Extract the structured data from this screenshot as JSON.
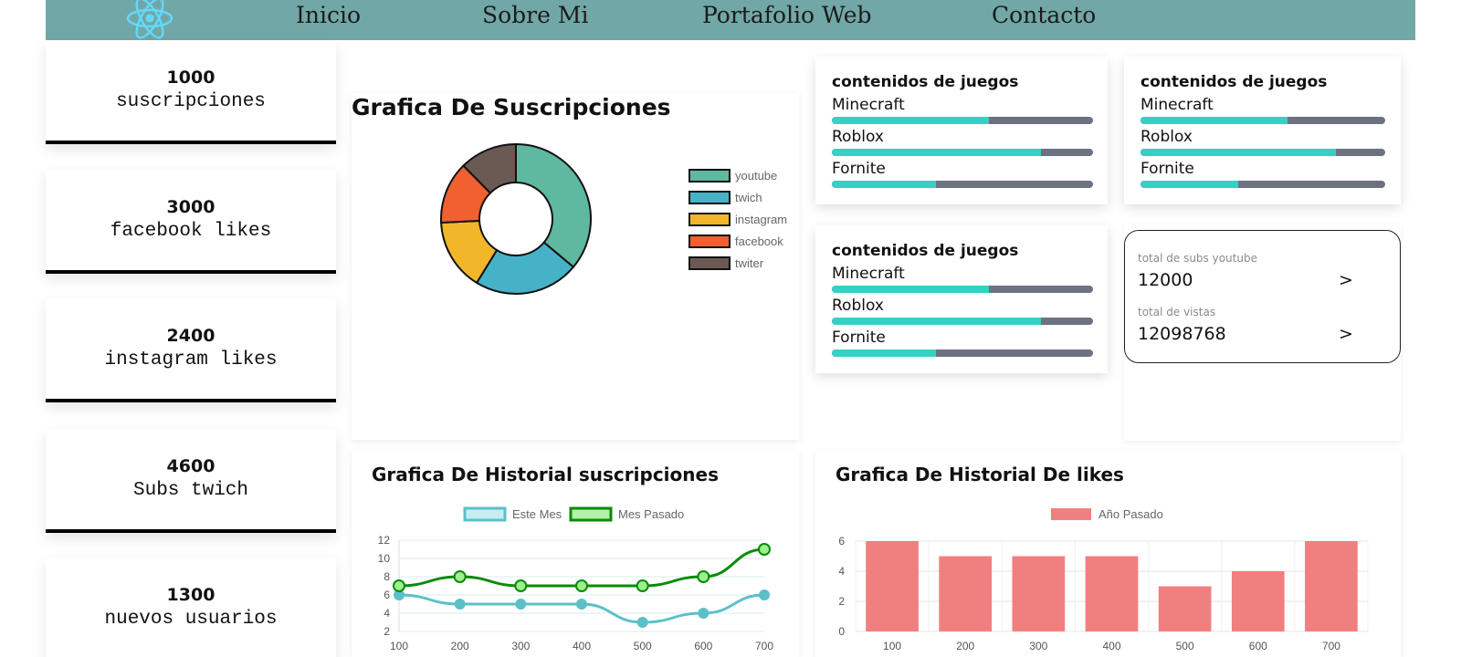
{
  "nav": {
    "links": [
      "Inicio",
      "Sobre Mi",
      "Portafolio Web",
      "Contacto"
    ],
    "logo_icon": "react-atom-icon",
    "logo_color": "#61dafb",
    "bg_color": "#72a7a7"
  },
  "stats": [
    {
      "value": "1000",
      "label": "suscripciones"
    },
    {
      "value": "3000",
      "label": "facebook likes"
    },
    {
      "value": "2400",
      "label": "instagram likes"
    },
    {
      "value": "4600",
      "label": "Subs twich"
    },
    {
      "value": "1300",
      "label": "nuevos usuarios"
    }
  ],
  "game_cards": [
    {
      "title": "contenidos de juegos",
      "items": [
        {
          "name": "Minecraft",
          "progress": 0.6
        },
        {
          "name": "Roblox",
          "progress": 0.8
        },
        {
          "name": "Fornite",
          "progress": 0.4
        }
      ]
    },
    {
      "title": "contenidos de juegos",
      "items": [
        {
          "name": "Minecraft",
          "progress": 0.6
        },
        {
          "name": "Roblox",
          "progress": 0.8
        },
        {
          "name": "Fornite",
          "progress": 0.4
        }
      ]
    },
    {
      "title": "contenidos de juegos",
      "items": [
        {
          "name": "Minecraft",
          "progress": 0.6
        },
        {
          "name": "Roblox",
          "progress": 0.8
        },
        {
          "name": "Fornite",
          "progress": 0.4
        }
      ]
    }
  ],
  "totals": {
    "subs_label": "total de subs youtube",
    "subs_value": "12000",
    "views_label": "total de vistas",
    "views_value": "12098768",
    "arrow": ">"
  },
  "colors": {
    "bar_fill": "#33d2c4",
    "bar_track": "#6d7280"
  },
  "chart_data": [
    {
      "type": "pie",
      "variant": "doughnut",
      "title": "Grafica De Suscripciones",
      "labels": [
        "youtube",
        "twich",
        "instagram",
        "facebook",
        "twiter"
      ],
      "values": [
        35,
        22,
        15,
        13,
        12
      ],
      "colors": [
        "#5fb8a0",
        "#45b2c7",
        "#f1b62a",
        "#f06030",
        "#6b5a54"
      ],
      "legend": "right"
    },
    {
      "type": "line",
      "title": "Grafica De Historial suscripciones",
      "x": [
        100,
        200,
        300,
        400,
        500,
        600,
        700
      ],
      "series": [
        {
          "name": "Este Mes",
          "values": [
            6,
            5,
            5,
            5,
            3,
            4,
            6
          ],
          "color": "#5bc0c8"
        },
        {
          "name": "Mes Pasado",
          "values": [
            7,
            8,
            7,
            7,
            7,
            8,
            11
          ],
          "color": "#0a8a0a"
        }
      ],
      "ylim": [
        2,
        12
      ],
      "yticks": [
        2,
        4,
        6,
        8,
        10,
        12
      ],
      "legend": "top",
      "grid": true
    },
    {
      "type": "bar",
      "title": "Grafica De Historial De likes",
      "categories": [
        "100",
        "200",
        "300",
        "400",
        "500",
        "600",
        "700"
      ],
      "series": [
        {
          "name": "Año Pasado",
          "values": [
            6,
            5,
            5,
            5,
            3,
            4,
            6
          ],
          "color": "#f08080"
        }
      ],
      "ylim": [
        0,
        6
      ],
      "yticks": [
        0,
        2,
        4,
        6
      ],
      "legend": "top",
      "grid": true
    }
  ]
}
